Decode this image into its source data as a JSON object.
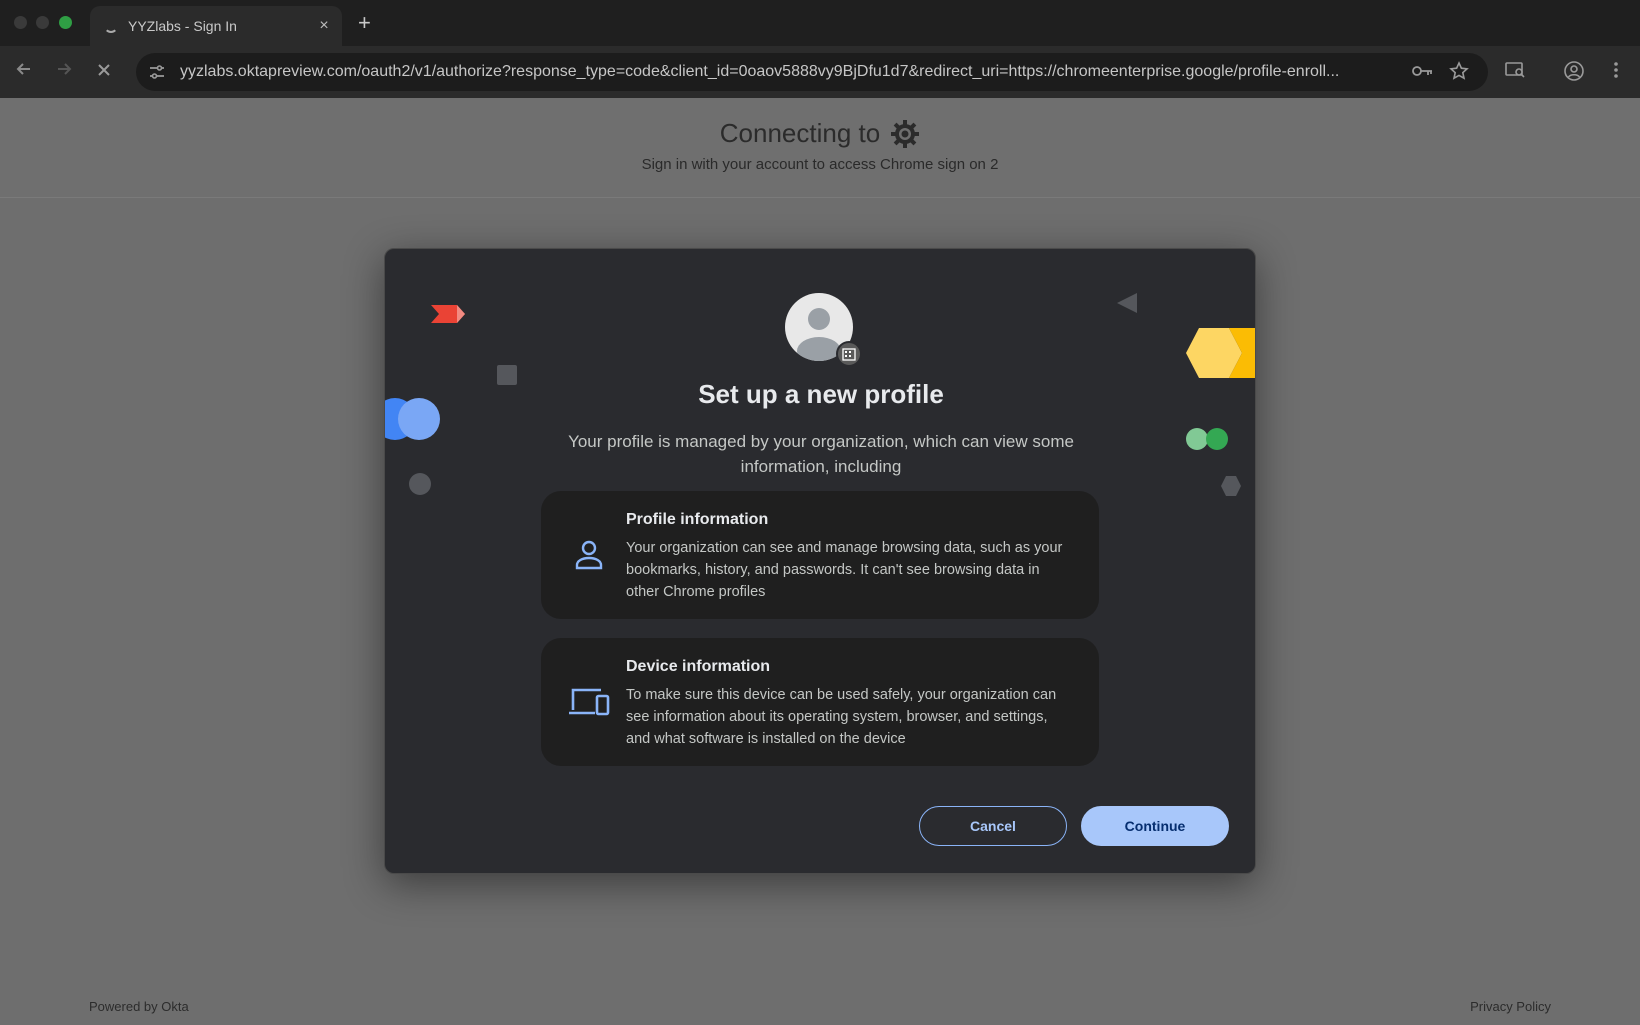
{
  "browser": {
    "tab_title": "YYZlabs - Sign In",
    "tab_close": "×",
    "new_tab": "+",
    "url": "yyzlabs.oktapreview.com/oauth2/v1/authorize?response_type=code&client_id=0oaov5888vy9BjDfu1d7&redirect_uri=https://chromeenterprise.google/profile-enroll..."
  },
  "page": {
    "connect_title": "Connecting to",
    "connect_subtitle": "Sign in with your account to access Chrome sign on 2",
    "footer_left": "Powered by Okta",
    "footer_right": "Privacy Policy"
  },
  "dialog": {
    "title": "Set up a new profile",
    "description": "Your profile is managed by your organization, which can view some information, including",
    "cards": [
      {
        "icon": "person-icon",
        "title": "Profile information",
        "text": "Your organization can see and manage browsing data, such as your bookmarks, history, and passwords. It can't see browsing data in other Chrome profiles"
      },
      {
        "icon": "devices-icon",
        "title": "Device information",
        "text": "To make sure this device can be used safely, your organization can see information about its operating system, browser, and settings, and what software is installed on the device"
      }
    ],
    "cancel_label": "Cancel",
    "continue_label": "Continue"
  },
  "colors": {
    "accent": "#a8c7fa",
    "dialog_bg": "#2a2b2f",
    "card_bg": "#1f1f1f",
    "deco_red": "#ea4335",
    "deco_blue": "#4285f4",
    "deco_yellow": "#fbbc04",
    "deco_green": "#34a853"
  }
}
